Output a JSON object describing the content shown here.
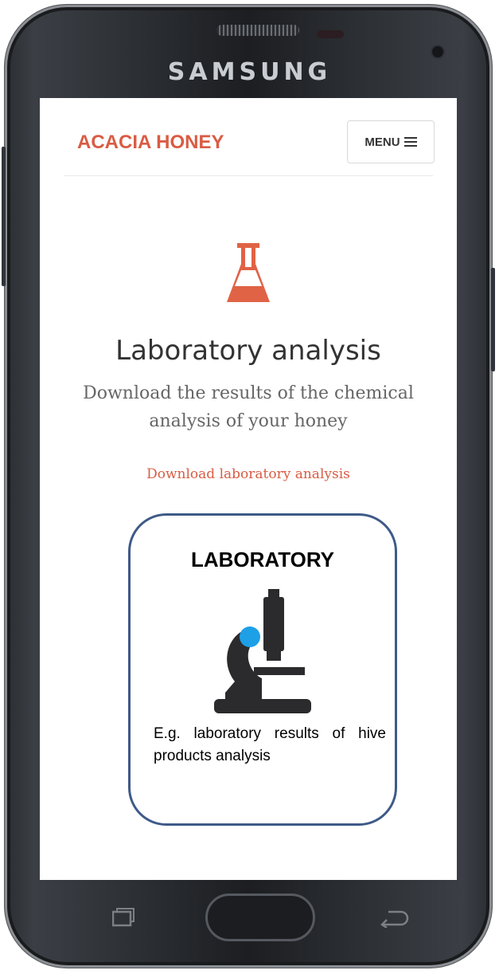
{
  "device": {
    "brand": "SAMSUNG"
  },
  "site": {
    "logo": "ACACIA HONEY",
    "menu_label": "MENU",
    "menu_icon": "hamburger-icon",
    "accent_color": "#d95c43"
  },
  "section": {
    "icon": "flask-icon",
    "title": "Laboratory analysis",
    "subtitle": "Download the results of the chemical analysis of your honey",
    "download_link": "Download laboratory analysis"
  },
  "callout": {
    "title": "LABORATORY",
    "icon": "microscope-icon",
    "description": "E.g. laboratory results of hive products analysis",
    "border_color": "#3e5a88"
  },
  "nav_bar": {
    "icons": [
      "recent-apps-icon",
      "home-button",
      "back-icon"
    ]
  }
}
